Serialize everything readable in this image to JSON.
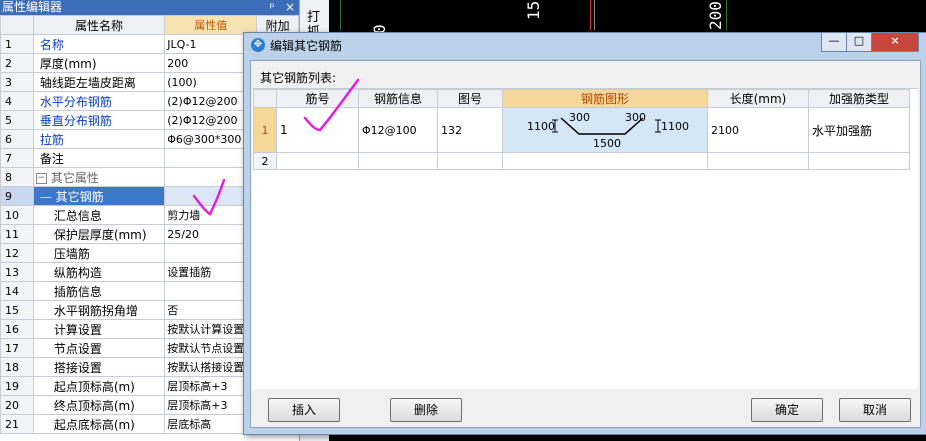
{
  "cad": {
    "labels": [
      "0",
      "15",
      "200"
    ]
  },
  "strip": {
    "label": "打 抓"
  },
  "panel": {
    "title": "属性编辑器",
    "title_buttons": [
      "ᵖ",
      "×"
    ],
    "headers": {
      "name": "属性名称",
      "value": "属性值",
      "extra": "附加"
    },
    "rows": [
      {
        "num": "1",
        "name": "名称",
        "value": "JLQ-1"
      },
      {
        "num": "2",
        "name": "厚度(mm)",
        "value": "200"
      },
      {
        "num": "3",
        "name": "轴线距左墙皮距离",
        "value": "(100)"
      },
      {
        "num": "4",
        "name": "水平分布钢筋",
        "value": "(2)Φ12@200"
      },
      {
        "num": "5",
        "name": "垂直分布钢筋",
        "value": "(2)Φ12@200"
      },
      {
        "num": "6",
        "name": "拉筋",
        "value": "Φ6@300*300"
      },
      {
        "num": "7",
        "name": "备注",
        "value": ""
      },
      {
        "num": "8",
        "name": "其它属性",
        "value": ""
      },
      {
        "num": "9",
        "name": "其它钢筋",
        "value": ""
      },
      {
        "num": "10",
        "name": "汇总信息",
        "value": "剪力墙"
      },
      {
        "num": "11",
        "name": "保护层厚度(mm)",
        "value": "25/20"
      },
      {
        "num": "12",
        "name": "压墙筋",
        "value": ""
      },
      {
        "num": "13",
        "name": "纵筋构造",
        "value": "设置插筋"
      },
      {
        "num": "14",
        "name": "插筋信息",
        "value": ""
      },
      {
        "num": "15",
        "name": "水平钢筋拐角增",
        "value": "否"
      },
      {
        "num": "16",
        "name": "计算设置",
        "value": "按默认计算设置"
      },
      {
        "num": "17",
        "name": "节点设置",
        "value": "按默认节点设置"
      },
      {
        "num": "18",
        "name": "搭接设置",
        "value": "按默认搭接设置"
      },
      {
        "num": "19",
        "name": "起点顶标高(m)",
        "value": "层顶标高+3"
      },
      {
        "num": "20",
        "name": "终点顶标高(m)",
        "value": "层顶标高+3"
      },
      {
        "num": "21",
        "name": "起点底标高(m)",
        "value": "层底标高"
      }
    ]
  },
  "dialog": {
    "title": "编辑其它钢筋",
    "window_buttons": [
      "—",
      "□",
      "×"
    ],
    "list_label": "其它钢筋列表:",
    "columns": [
      "筋号",
      "钢筋信息",
      "图号",
      "钢筋图形",
      "长度(mm)",
      "加强筋类型"
    ],
    "rows": [
      {
        "rn": "1",
        "bar_no": "1",
        "bar_info": "Φ12@100",
        "fig_no": "132",
        "length": "2100",
        "type": "水平加强筋",
        "shape": {
          "left": "1100",
          "seg1": "300",
          "seg2": "300",
          "right": "1100",
          "bottom": "1500"
        }
      },
      {
        "rn": "2",
        "bar_no": "",
        "bar_info": "",
        "fig_no": "",
        "length": "",
        "type": ""
      }
    ],
    "buttons": {
      "insert": "插入",
      "delete": "删除",
      "ok": "确定",
      "cancel": "取消"
    }
  },
  "colors": {
    "accent": "#3d6fb8",
    "annotation": "#e020e0",
    "header_active": "#f6d79a"
  }
}
